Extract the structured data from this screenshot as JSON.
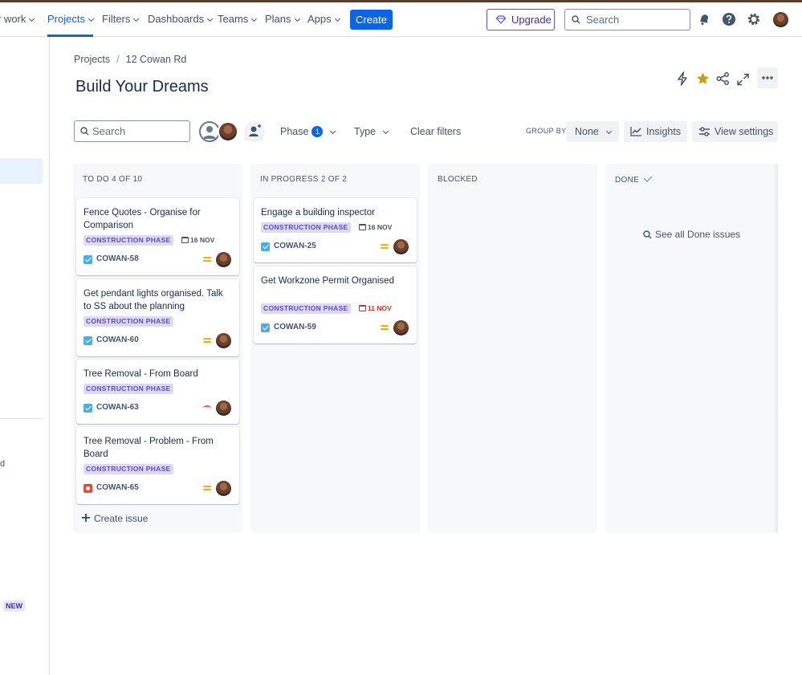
{
  "nav": {
    "items": [
      {
        "label": "r work"
      },
      {
        "label": "Projects"
      },
      {
        "label": "Filters"
      },
      {
        "label": "Dashboards"
      },
      {
        "label": "Teams"
      },
      {
        "label": "Plans"
      },
      {
        "label": "Apps"
      }
    ],
    "create_label": "Create",
    "upgrade_label": "Upgrade",
    "search_placeholder": "Search",
    "accent": "#0c66e4"
  },
  "sidebar": {
    "fragment": "d",
    "new_badge": "NEW"
  },
  "breadcrumb": {
    "projects": "Projects",
    "separator": "/",
    "project": "12 Cowan Rd"
  },
  "page": {
    "title": "Build Your Dreams"
  },
  "toolbar": {
    "search_placeholder": "Search",
    "phase_label": "Phase",
    "phase_count": "1",
    "type_label": "Type",
    "clear_filters": "Clear filters",
    "group_by_label": "GROUP BY",
    "group_by_value": "None",
    "insights_label": "Insights",
    "view_settings_label": "View settings"
  },
  "columns": {
    "todo": {
      "header": "TO DO 4 OF 10",
      "cards": [
        {
          "title": "Fence Quotes - Organise for Comparison",
          "phase": "CONSTRUCTION PHASE",
          "due": "16 NOV",
          "key": "COWAN-58",
          "type": "task-icon",
          "priority": "medium"
        },
        {
          "title": "Get pendant lights organised. Talk to SS about the planning",
          "phase": "CONSTRUCTION PHASE",
          "key": "COWAN-60",
          "type": "task-icon",
          "priority": "medium"
        },
        {
          "title": "Tree Removal - From Board",
          "phase": "CONSTRUCTION PHASE",
          "key": "COWAN-63",
          "type": "task-icon",
          "priority": "high"
        },
        {
          "title": "Tree Removal - Problem - From Board",
          "phase": "CONSTRUCTION PHASE",
          "key": "COWAN-65",
          "type": "bug-icon",
          "priority": "medium"
        }
      ],
      "create_issue": "Create issue"
    },
    "in_progress": {
      "header": "IN PROGRESS 2 OF 2",
      "cards": [
        {
          "title": "Engage a building inspector",
          "phase": "CONSTRUCTION PHASE",
          "due": "16 NOV",
          "key": "COWAN-25",
          "type": "task-icon",
          "priority": "medium"
        },
        {
          "title": "Get Workzone Permit Organised",
          "phase": "CONSTRUCTION PHASE",
          "due": "11 NOV",
          "due_color": "#c9372c",
          "key": "COWAN-59",
          "type": "task-icon",
          "priority": "medium"
        }
      ]
    },
    "blocked": {
      "header": "BLOCKED"
    },
    "done": {
      "header": "DONE",
      "see_all": "See all Done issues"
    }
  }
}
